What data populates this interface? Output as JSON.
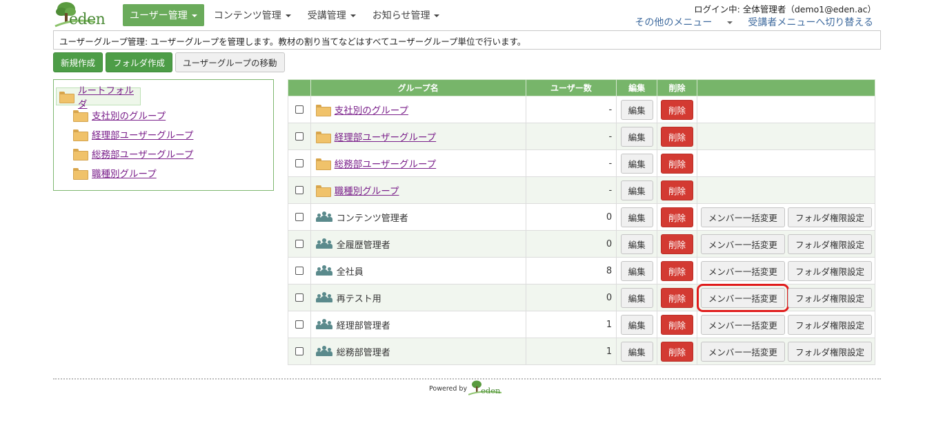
{
  "brand": {
    "name": "eden"
  },
  "nav": [
    {
      "label": "ユーザー管理",
      "active": true
    },
    {
      "label": "コンテンツ管理",
      "active": false
    },
    {
      "label": "受講管理",
      "active": false
    },
    {
      "label": "お知らせ管理",
      "active": false
    }
  ],
  "header": {
    "login": "ログイン中: 全体管理者（demo1@eden.ac）",
    "other_menu": "その他のメニュー",
    "switch_menu": "受講者メニューへ切り替える"
  },
  "description": "ユーザーグループ管理: ユーザーグループを管理します。教材の割り当てなどはすべてユーザーグループ単位で行います。",
  "actions": {
    "new": "新規作成",
    "folder": "フォルダ作成",
    "move": "ユーザーグループの移動"
  },
  "tree": {
    "root": "ルートフォルダ",
    "items": [
      "支社別のグループ",
      "経理部ユーザーグループ",
      "総務部ユーザーグループ",
      "職種別グループ"
    ]
  },
  "table": {
    "headers": {
      "name": "グループ名",
      "count": "ユーザー数",
      "edit": "編集",
      "delete": "削除"
    },
    "edit_label": "編集",
    "delete_label": "削除",
    "member_label": "メンバー一括変更",
    "perm_label": "フォルダ権限設定",
    "rows": [
      {
        "type": "folder",
        "name": "支社別のグループ",
        "count": "-"
      },
      {
        "type": "folder",
        "name": "経理部ユーザーグループ",
        "count": "-"
      },
      {
        "type": "folder",
        "name": "総務部ユーザーグループ",
        "count": "-"
      },
      {
        "type": "folder",
        "name": "職種別グループ",
        "count": "-"
      },
      {
        "type": "group",
        "name": "コンテンツ管理者",
        "count": "0"
      },
      {
        "type": "group",
        "name": "全履歴管理者",
        "count": "0"
      },
      {
        "type": "group",
        "name": "全社員",
        "count": "8"
      },
      {
        "type": "group",
        "name": "再テスト用",
        "count": "0",
        "highlight": true
      },
      {
        "type": "group",
        "name": "経理部管理者",
        "count": "1"
      },
      {
        "type": "group",
        "name": "総務部管理者",
        "count": "1"
      }
    ]
  },
  "footer": {
    "powered_by": "Powered by",
    "logo": "eden"
  },
  "colors": {
    "accent_green": "#6aab5b",
    "button_green": "#4d9d47",
    "delete_red": "#d33a32",
    "highlight_red": "#e01b1b",
    "link_purple": "#7a1f8a"
  }
}
